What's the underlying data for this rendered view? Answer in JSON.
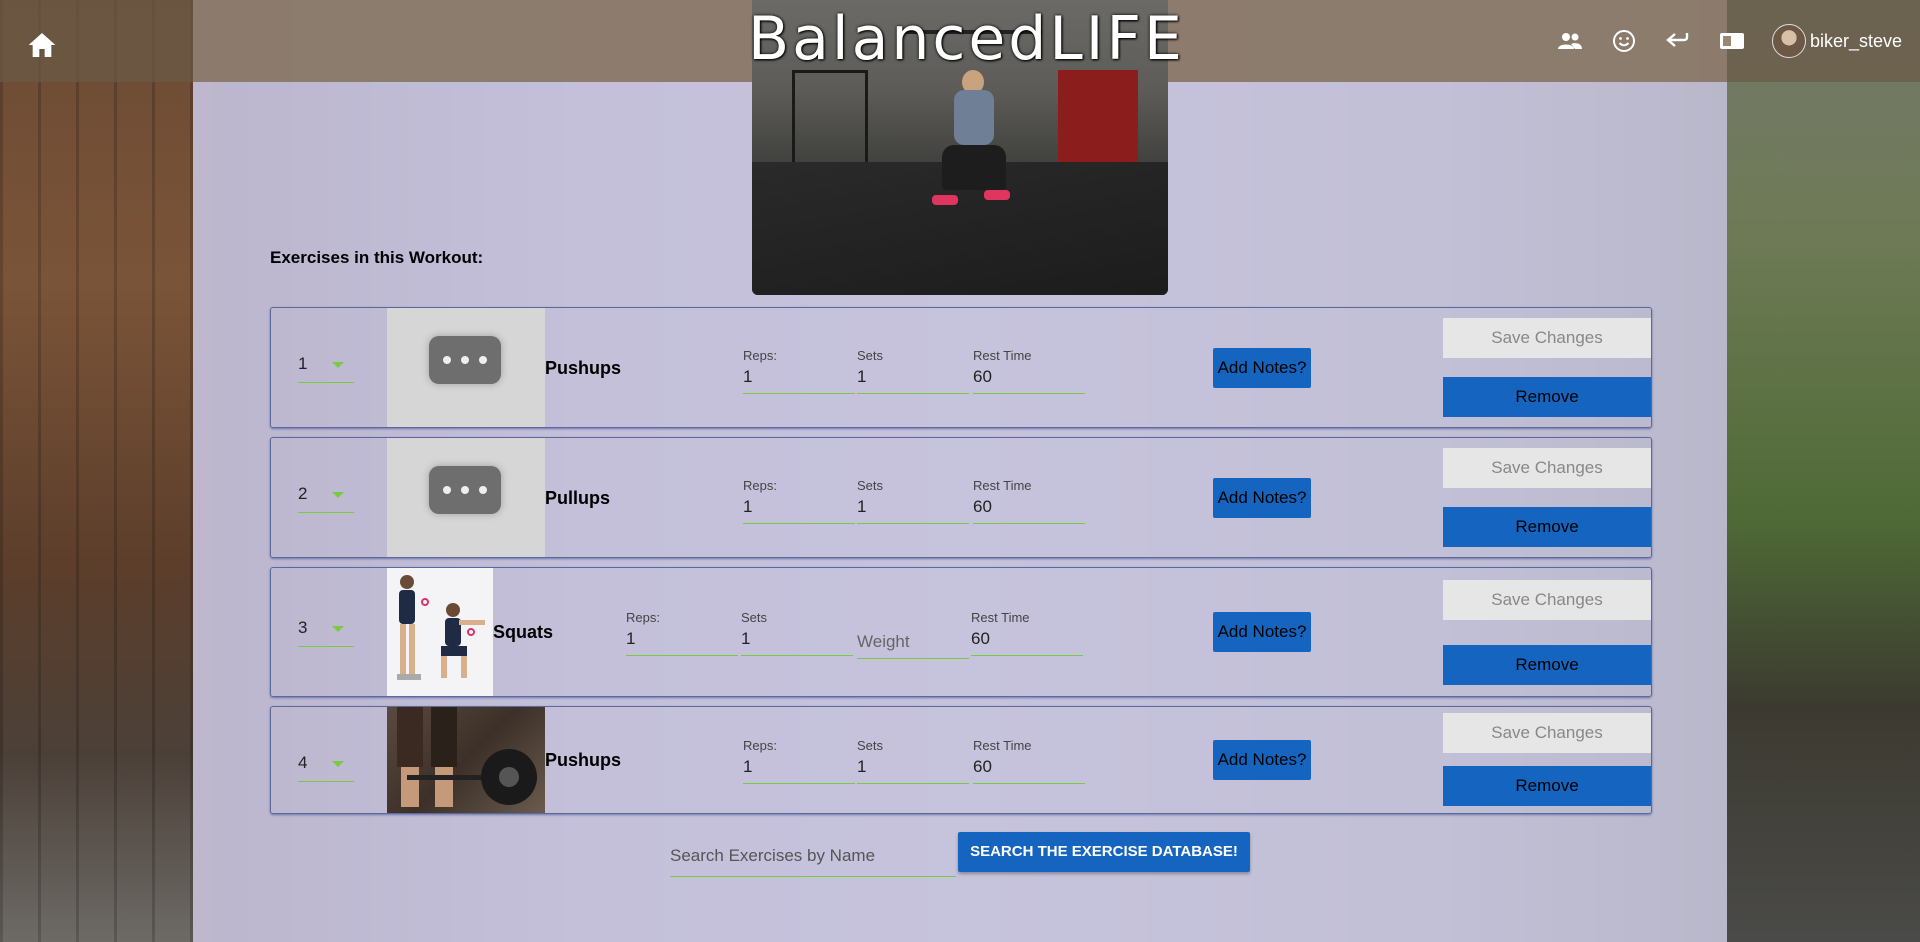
{
  "header": {
    "brand": "BalancedLIFE",
    "username": "biker_steve",
    "icons": [
      "home-icon",
      "people-icon",
      "smiley-icon",
      "back-arrow-icon",
      "sidebar-icon"
    ]
  },
  "workout": {
    "section_label": "Exercises in this Workout:",
    "field_labels": {
      "reps": "Reps:",
      "sets": "Sets",
      "rest": "Rest Time",
      "weight_placeholder": "Weight"
    },
    "buttons": {
      "notes": "Add Notes?",
      "save": "Save Changes",
      "remove": "Remove"
    },
    "exercises": [
      {
        "order": "1",
        "name": "Pushups",
        "reps": "1",
        "sets": "1",
        "rest": "60",
        "thumb": "placeholder"
      },
      {
        "order": "2",
        "name": "Pullups",
        "reps": "1",
        "sets": "1",
        "rest": "60",
        "thumb": "placeholder"
      },
      {
        "order": "3",
        "name": "Squats",
        "reps": "1",
        "sets": "1",
        "rest": "60",
        "thumb": "squat-photo"
      },
      {
        "order": "4",
        "name": "Pushups",
        "reps": "1",
        "sets": "1",
        "rest": "60",
        "thumb": "deadlift-photo"
      }
    ]
  },
  "search": {
    "placeholder": "Search Exercises by Name",
    "button": "SEARCH THE EXERCISE DATABASE!"
  },
  "colors": {
    "primary_button": "#1565c0",
    "underline": "#7ac943",
    "save_button": "#e6e6e6"
  }
}
